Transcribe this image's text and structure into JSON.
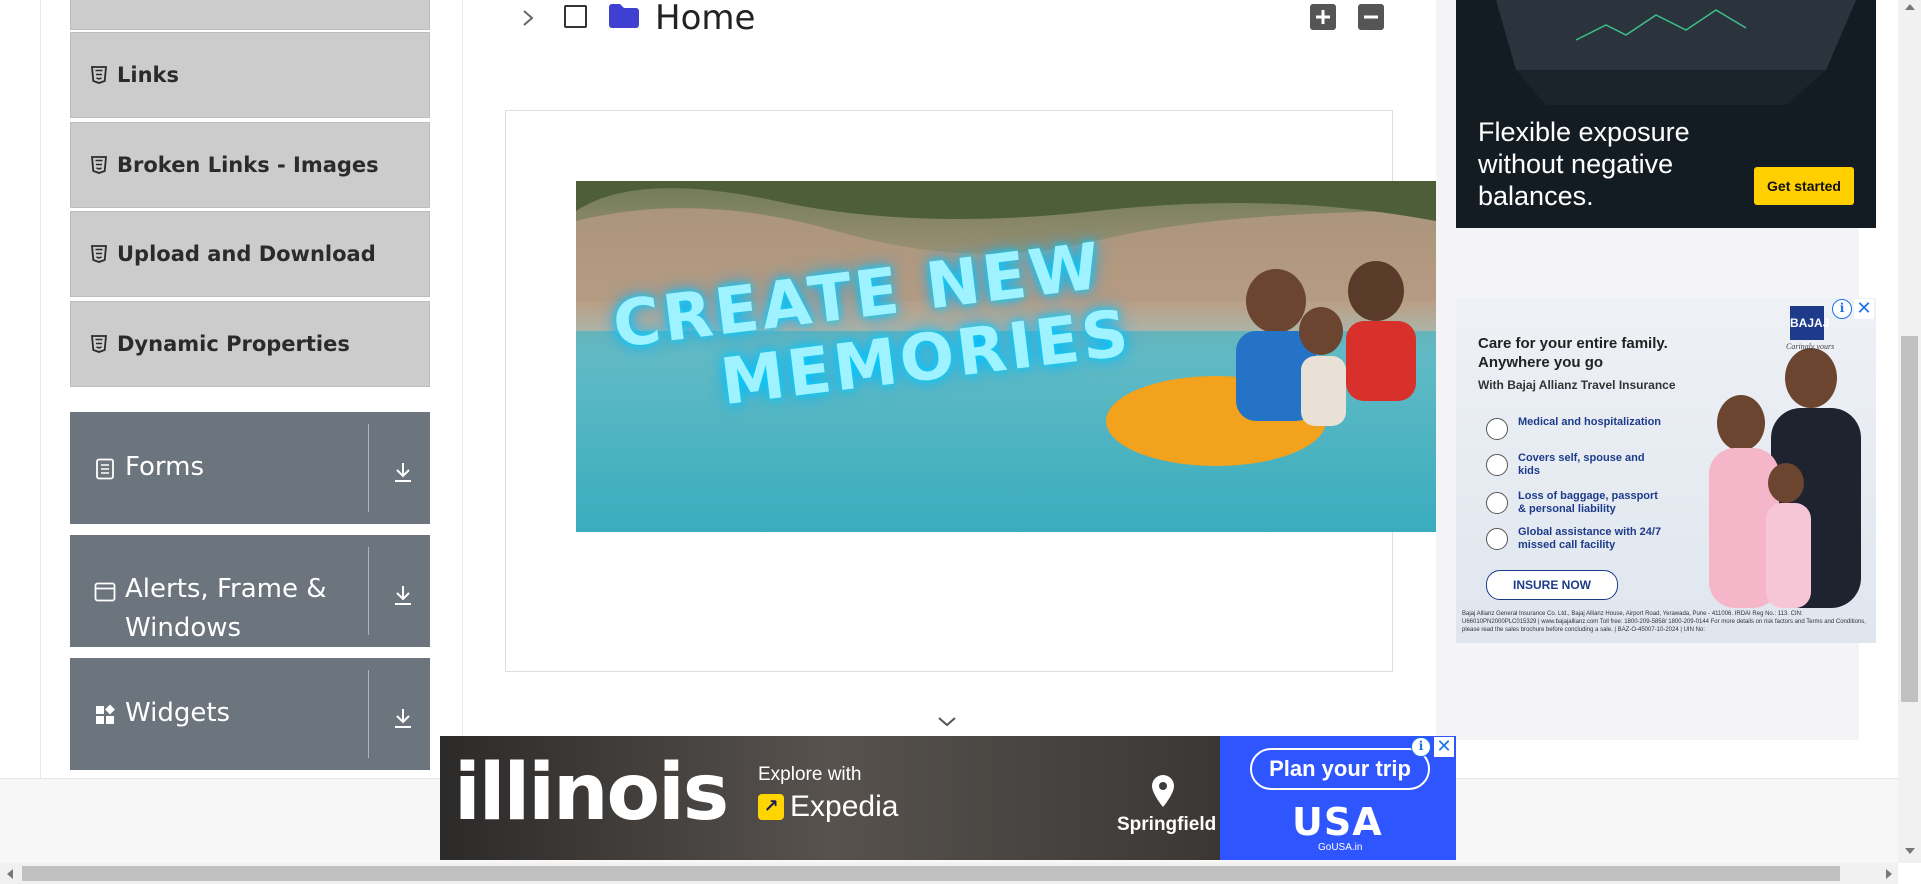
{
  "sidebar": {
    "sub_items": [
      {
        "label": ""
      },
      {
        "label": "Links"
      },
      {
        "label": "Broken Links - Images"
      },
      {
        "label": "Upload and Download"
      },
      {
        "label": "Dynamic Properties"
      }
    ],
    "groups": [
      {
        "label": "Forms"
      },
      {
        "label": "Alerts, Frame & Windows"
      },
      {
        "label": "Widgets"
      }
    ]
  },
  "tree": {
    "root_label": "Home"
  },
  "banner_ad": {
    "line1": "CREATE NEW",
    "line2": "MEMORIES"
  },
  "right_ad_top": {
    "text": "Flexible exposure without negative balances.",
    "button": "Get started"
  },
  "right_ad_insurance": {
    "brand": "BAJAJ",
    "tagline": "Caringly yours",
    "headline": "Care for your entire family. Anywhere you go",
    "subhead": "With Bajaj Allianz Travel Insurance",
    "features": [
      "Medical and hospitalization",
      "Covers self, spouse and kids",
      "Loss of baggage, passport & personal liability",
      "Global assistance with 24/7 missed call facility"
    ],
    "cta": "INSURE NOW",
    "fine_print": "Bajaj Allianz General Insurance Co. Ltd., Bajaj Allianz House, Airport Road, Yerawada, Pune - 411006. IRDAI Reg No.: 113. CIN: U66010PN2000PLC015329 | www.bajajallianz.com Toll free: 1800-209-5858/ 1800-209-0144 For more details on risk factors and Terms and Conditions, please read the sales brochure before concluding a sale. | BAZ-O-45007-10-2024 | UIN No:"
  },
  "bottom_ad": {
    "logo": "illinois",
    "explore": "Explore with",
    "partner": "Expedia",
    "city": "Springfield",
    "cta": "Plan your trip",
    "usa": "USA",
    "site": "GoUSA.in"
  },
  "ad_controls": {
    "info": "i",
    "close": "✕"
  },
  "colors": {
    "sidebar_sub_bg": "#cccccc",
    "sidebar_group_bg": "#6c757d",
    "folder": "#3f3fd1",
    "ad_cta_yellow": "#ffcf00",
    "ad_blue": "#2f55ff"
  }
}
